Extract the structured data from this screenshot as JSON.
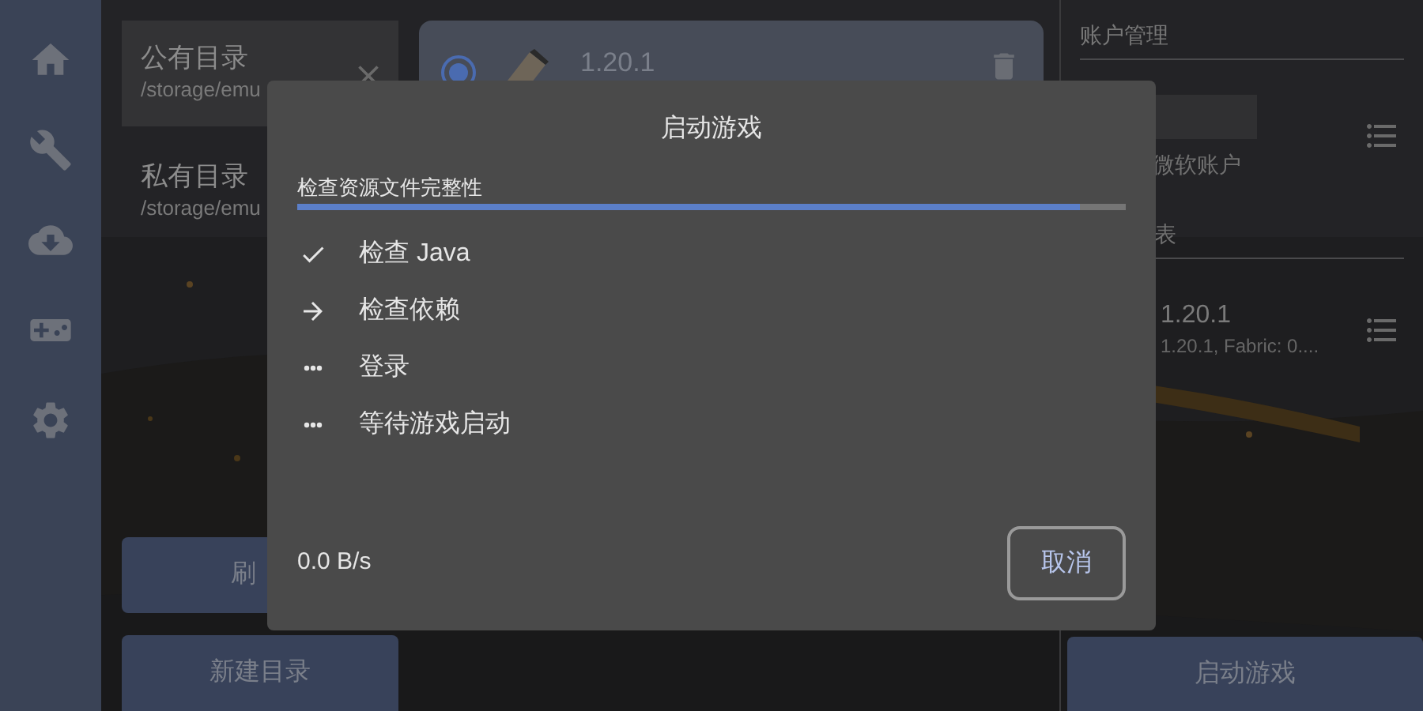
{
  "sidebar": {
    "items": [
      {
        "kind": "home"
      },
      {
        "kind": "tools"
      },
      {
        "kind": "download"
      },
      {
        "kind": "game"
      },
      {
        "kind": "settings"
      }
    ]
  },
  "directories": {
    "items": [
      {
        "name": "公有目录",
        "path": "/storage/emu",
        "selected": true
      },
      {
        "name": "私有目录",
        "path": "/storage/emu",
        "selected": false
      }
    ],
    "buttons": [
      "刷",
      "新建目录"
    ]
  },
  "versions": {
    "items": [
      {
        "name": "1.20.1",
        "selected": true
      }
    ]
  },
  "account_panel": {
    "title": "账户管理",
    "account": {
      "name": "微软账户"
    },
    "list_title": "表",
    "versions": [
      {
        "name": "1.20.1",
        "detail": "1.20.1, Fabric: 0...."
      }
    ],
    "launch_button": "启动游戏"
  },
  "dialog": {
    "title": "启动游戏",
    "task": {
      "label": "检查资源文件完整性",
      "level": 0.945
    },
    "steps": [
      {
        "label": "检查 Java",
        "kind": "done"
      },
      {
        "label": "检查依赖",
        "kind": "running"
      },
      {
        "label": "登录",
        "kind": "pending"
      },
      {
        "label": "等待游戏启动",
        "kind": "pending"
      }
    ],
    "speed": "0.0 B/s",
    "cancel": "取消"
  }
}
